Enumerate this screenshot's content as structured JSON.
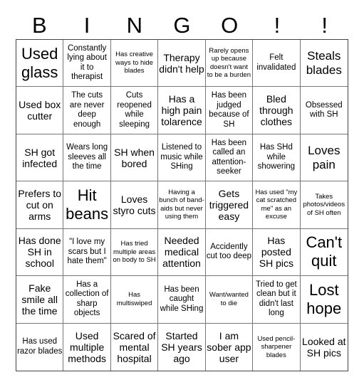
{
  "header": [
    "B",
    "I",
    "N",
    "G",
    "O",
    "!",
    "!"
  ],
  "cells": [
    [
      "Used glass",
      "Constantly lying about it to therapist",
      "Has creative ways to hide blades",
      "Therapy didn't help",
      "Rarely opens up because doesn't want to be a burden",
      "Felt invalidated",
      "Steals blades"
    ],
    [
      "Used box cutter",
      "The cuts are never deep enough",
      "Cuts reopened while sleeping",
      "Has a high pain tolarence",
      "Has been judged because of SH",
      "Bled through clothes",
      "Obsessed with SH"
    ],
    [
      "SH got infected",
      "Wears long sleeves all the time",
      "SH when bored",
      "Listened to music while SHing",
      "Has been called an attention-seeker",
      "Has SHd while showering",
      "Loves pain"
    ],
    [
      "Prefers to cut on arms",
      "Hit beans",
      "Loves styro cuts",
      "Having a bunch of band-aids but never using them",
      "Gets triggered easy",
      "Has used \"my cat scratched me\" as an excuse",
      "Takes photos/videos of SH often"
    ],
    [
      "Has done SH in school",
      "\"I love my scars but I hate them\"",
      "Has tried multiple areas on body to SH",
      "Needed medical attention",
      "Accidently cut too deep",
      "Has posted SH pics",
      "Can't quit"
    ],
    [
      "Fake smile all the time",
      "Has a collection of sharp objects",
      "Has multiswiped",
      "Has been caught while SHing",
      "Want/wanted to die",
      "Tried to get clean but it didn't last long",
      "Lost hope"
    ],
    [
      "Has used razor blades",
      "Used multiple methods",
      "Scared of mental hospital",
      "Started SH years ago",
      "I am sober app user",
      "Used pencil-sharpener blades",
      "Looked at SH pics"
    ]
  ]
}
